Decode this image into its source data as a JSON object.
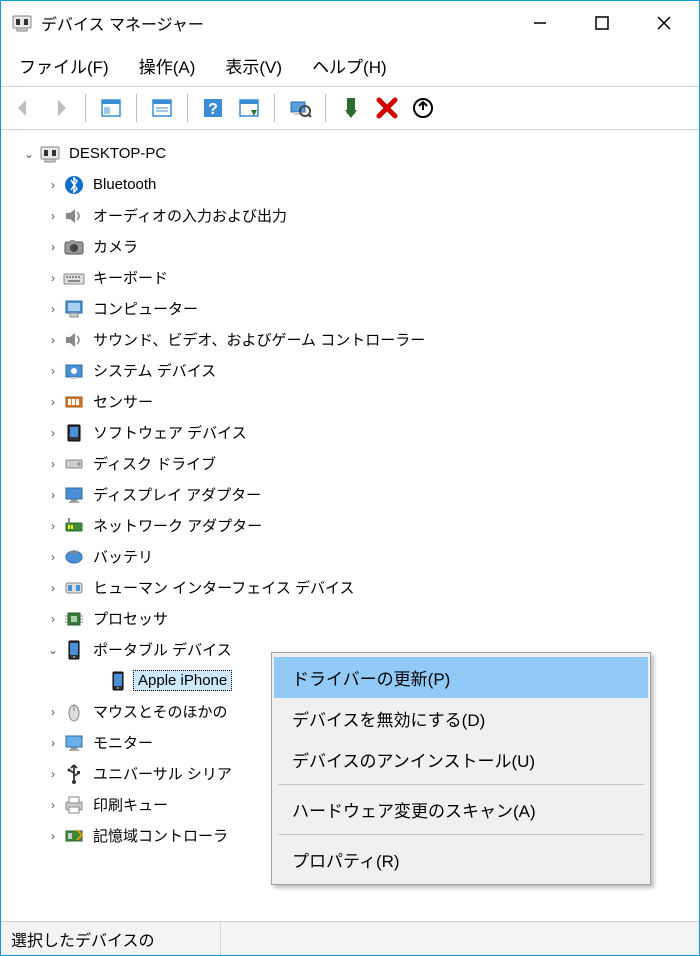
{
  "window": {
    "title": "デバイス マネージャー"
  },
  "menu": {
    "file": "ファイル(F)",
    "action": "操作(A)",
    "view": "表示(V)",
    "help": "ヘルプ(H)"
  },
  "tree": {
    "root": "DESKTOP-PC",
    "items": [
      {
        "label": "Bluetooth",
        "icon": "bluetooth",
        "exp": ">"
      },
      {
        "label": "オーディオの入力および出力",
        "icon": "audio",
        "exp": ">"
      },
      {
        "label": "カメラ",
        "icon": "camera",
        "exp": ">"
      },
      {
        "label": "キーボード",
        "icon": "keyboard",
        "exp": ">"
      },
      {
        "label": "コンピューター",
        "icon": "computer",
        "exp": ">"
      },
      {
        "label": "サウンド、ビデオ、およびゲーム コントローラー",
        "icon": "sound",
        "exp": ">"
      },
      {
        "label": "システム デバイス",
        "icon": "system",
        "exp": ">"
      },
      {
        "label": "センサー",
        "icon": "sensor",
        "exp": ">"
      },
      {
        "label": "ソフトウェア デバイス",
        "icon": "software",
        "exp": ">"
      },
      {
        "label": "ディスク ドライブ",
        "icon": "disk",
        "exp": ">"
      },
      {
        "label": "ディスプレイ アダプター",
        "icon": "display",
        "exp": ">"
      },
      {
        "label": "ネットワーク アダプター",
        "icon": "network",
        "exp": ">"
      },
      {
        "label": "バッテリ",
        "icon": "battery",
        "exp": ">"
      },
      {
        "label": "ヒューマン インターフェイス デバイス",
        "icon": "hid",
        "exp": ">"
      },
      {
        "label": "プロセッサ",
        "icon": "cpu",
        "exp": ">"
      },
      {
        "label": "ポータブル デバイス",
        "icon": "portable",
        "exp": "v",
        "children": [
          {
            "label": "Apple iPhone",
            "icon": "portable",
            "selected": true
          }
        ]
      },
      {
        "label": "マウスとそのほかの",
        "icon": "mouse",
        "exp": ">"
      },
      {
        "label": "モニター",
        "icon": "monitor",
        "exp": ">"
      },
      {
        "label": "ユニバーサル シリア",
        "icon": "usb",
        "exp": ">"
      },
      {
        "label": "印刷キュー",
        "icon": "printer",
        "exp": ">"
      },
      {
        "label": "記憶域コントローラ",
        "icon": "storage",
        "exp": ">"
      }
    ]
  },
  "context_menu": {
    "items": [
      {
        "label": "ドライバーの更新(P)",
        "highlight": true
      },
      {
        "label": "デバイスを無効にする(D)"
      },
      {
        "label": "デバイスのアンインストール(U)"
      },
      {
        "sep": true
      },
      {
        "label": "ハードウェア変更のスキャン(A)"
      },
      {
        "sep": true
      },
      {
        "label": "プロパティ(R)"
      }
    ]
  },
  "status": {
    "text": "選択したデバイスの"
  }
}
